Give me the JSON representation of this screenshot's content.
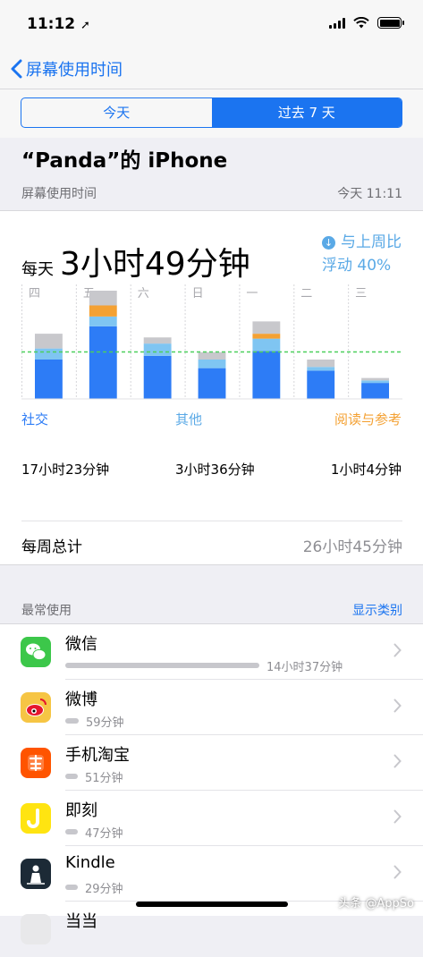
{
  "status": {
    "time": "11:12"
  },
  "nav": {
    "back_label": "屏幕使用时间"
  },
  "segment": {
    "today": "今天",
    "week": "过去 7 天"
  },
  "device_title": "“Panda”的 iPhone",
  "section": {
    "label": "屏幕使用时间",
    "timestamp": "今天 11:11"
  },
  "summary": {
    "prefix": "每天",
    "value": "3小时49分钟",
    "compare_line1": "与上周比",
    "compare_line2": "浮动 40%"
  },
  "colors": {
    "social": "#2d7cf6",
    "other": "#7fc5f2",
    "reading": "#f4a133",
    "misc": "#c8c8cc",
    "average": "#4ccf5d",
    "accent": "#1b74f0"
  },
  "chart_data": {
    "type": "bar",
    "categories": [
      "四",
      "五",
      "六",
      "日",
      "一",
      "二",
      "三"
    ],
    "series": [
      {
        "name": "社交",
        "values": [
          3.2,
          5.9,
          3.5,
          2.5,
          3.9,
          2.3,
          1.3
        ]
      },
      {
        "name": "其他",
        "values": [
          0.9,
          0.8,
          1.0,
          0.7,
          1.0,
          0.3,
          0.2
        ]
      },
      {
        "name": "阅读与参考",
        "values": [
          0,
          0.9,
          0,
          0,
          0.4,
          0,
          0
        ]
      },
      {
        "values": [
          1.2,
          1.2,
          0.5,
          0.6,
          1.0,
          0.6,
          0.2
        ]
      }
    ],
    "average": 3.82,
    "ylim": [
      0,
      8
    ],
    "grid": true
  },
  "legend": {
    "social": "社交",
    "other": "其他",
    "reading": "阅读与参考"
  },
  "totals": {
    "social": "17小时23分钟",
    "other": "3小时36分钟",
    "reading": "1小时4分钟"
  },
  "week_total": {
    "label": "每周总计",
    "value": "26小时45分钟"
  },
  "most_used": {
    "label": "最常使用",
    "link": "显示类别"
  },
  "apps": [
    {
      "name": "微信",
      "time": "14小时37分钟",
      "icon": "wechat-icon",
      "share": 0.96
    },
    {
      "name": "微博",
      "time": "59分钟",
      "icon": "weibo-icon",
      "share": 0.065
    },
    {
      "name": "手机淘宝",
      "time": "51分钟",
      "icon": "taobao-icon",
      "share": 0.058
    },
    {
      "name": "即刻",
      "time": "47分钟",
      "icon": "jike-icon",
      "share": 0.054
    },
    {
      "name": "Kindle",
      "time": "29分钟",
      "icon": "kindle-icon",
      "share": 0.035
    },
    {
      "name": "当当",
      "icon": "dangdang-icon"
    }
  ],
  "watermark": "头条 @AppSo"
}
